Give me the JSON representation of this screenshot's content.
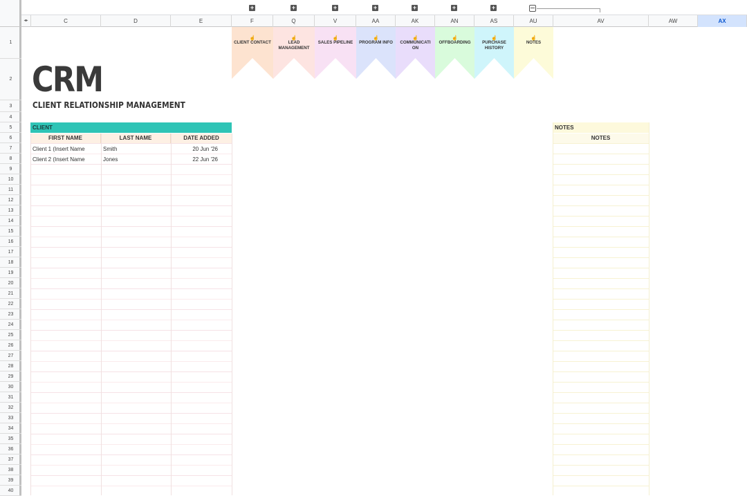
{
  "columns": [
    "C",
    "D",
    "E",
    "F",
    "Q",
    "V",
    "AA",
    "AK",
    "AN",
    "AS",
    "AU",
    "AV",
    "AW",
    "AX"
  ],
  "selected_column": "AX",
  "rows": [
    "1",
    "2",
    "3",
    "4",
    "5",
    "6",
    "7",
    "8",
    "9",
    "10",
    "11",
    "12",
    "13",
    "14",
    "15",
    "16",
    "17",
    "18",
    "19",
    "20",
    "21",
    "22",
    "23",
    "24",
    "25",
    "26",
    "27",
    "28",
    "29",
    "30",
    "31",
    "32",
    "33",
    "34",
    "35",
    "36",
    "37",
    "38",
    "39",
    "40"
  ],
  "title": "CRM",
  "subtitle": "CLIENT RELATIONSHIP MANAGEMENT",
  "tabs": [
    {
      "label": "CLIENT CONTACT",
      "color": "#fde3d0"
    },
    {
      "label": "LEAD MANAGEMENT",
      "color": "#fde4e1"
    },
    {
      "label": "SALES PIPELINE",
      "color": "#f8e1f4"
    },
    {
      "label": "PROGRAM INFO",
      "color": "#dbe3fb"
    },
    {
      "label": "COMMUNICATI ON",
      "color": "#e9ddfb"
    },
    {
      "label": "OFFBOARDING",
      "color": "#d9fbdc"
    },
    {
      "label": "PURCHASE HISTORY",
      "color": "#cff5fb"
    },
    {
      "label": "NOTES",
      "color": "#fdfbd9"
    }
  ],
  "client_table": {
    "section_label": "CLIENT",
    "headers": [
      "FIRST NAME",
      "LAST NAME",
      "DATE ADDED"
    ],
    "rows": [
      [
        "Client 1 (Insert Name",
        "Smith",
        "20 Jun '26"
      ],
      [
        "Client 2 (Insert Name",
        "Jones",
        "22 Jun '26"
      ]
    ]
  },
  "notes": {
    "section_label": "NOTES",
    "header": "NOTES"
  },
  "colors": {
    "accent": "#2ec4b6",
    "header_fill": "#fdf0e4",
    "notes_fill": "#fdf9dc",
    "selected_column": "#d3e3fd"
  }
}
